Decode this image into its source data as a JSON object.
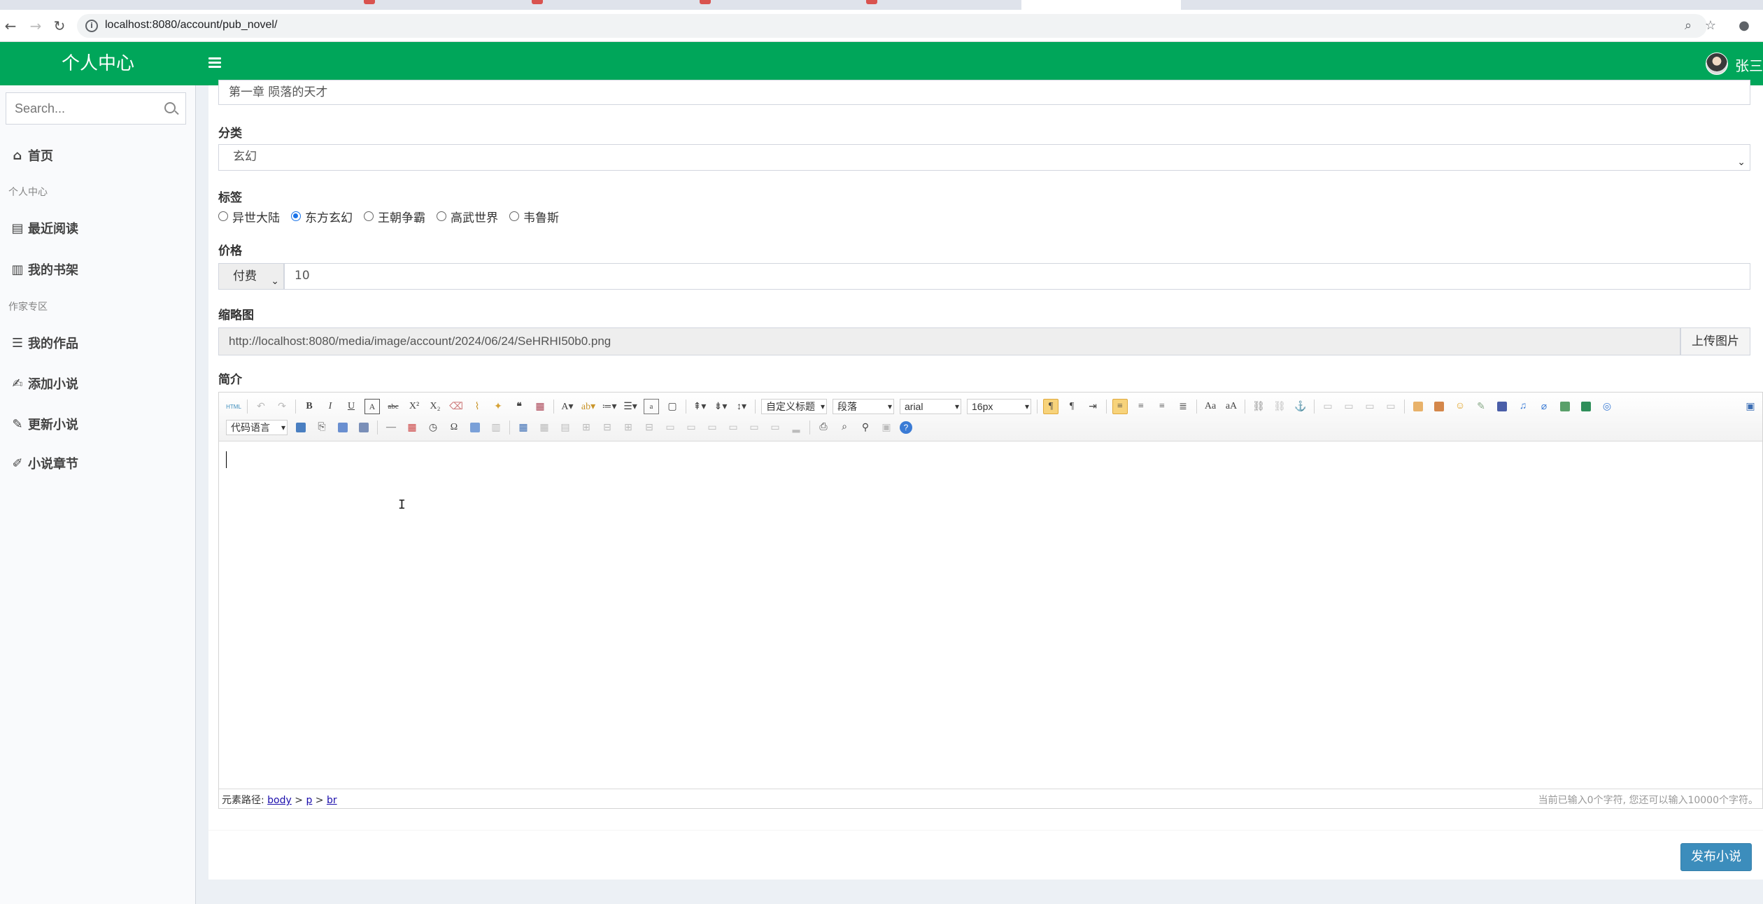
{
  "browser": {
    "url": "localhost:8080/account/pub_novel/"
  },
  "header": {
    "logo": "个人中心",
    "username": "张三"
  },
  "sidebar": {
    "search_placeholder": "Search...",
    "items": [
      {
        "label": "首页",
        "icon": "home-icon"
      },
      {
        "header": "个人中心"
      },
      {
        "label": "最近阅读",
        "icon": "book-open-icon"
      },
      {
        "label": "我的书架",
        "icon": "bookshelf-icon"
      },
      {
        "header": "作家专区"
      },
      {
        "label": "我的作品",
        "icon": "list-icon"
      },
      {
        "label": "添加小说",
        "icon": "pen-hand-icon"
      },
      {
        "label": "更新小说",
        "icon": "pencil-icon"
      },
      {
        "label": "小说章节",
        "icon": "edit-icon"
      }
    ]
  },
  "form": {
    "title_value": "第一章 陨落的天才",
    "category_label": "分类",
    "category_value": "玄幻",
    "tags_label": "标签",
    "tags": [
      "异世大陆",
      "东方玄幻",
      "王朝争霸",
      "高武世界",
      "韦鲁斯"
    ],
    "selected_tag": "东方玄幻",
    "price_label": "价格",
    "price_type": "付费",
    "price_value": "10",
    "thumb_label": "缩略图",
    "thumb_url": "http://localhost:8080/media/image/account/2024/06/24/SeHRHI50b0.png",
    "upload_button": "上传图片",
    "intro_label": "简介"
  },
  "editor": {
    "toolbar": {
      "html_btn": "HTML",
      "custom_title": "自定义标题",
      "paragraph": "段落",
      "font_family": "arial",
      "font_size": "16px",
      "code_lang": "代码语言"
    },
    "path_label": "元素路径:",
    "path": [
      "body",
      "p",
      "br"
    ],
    "word_count": "当前已输入0个字符, 您还可以输入10000个字符。"
  },
  "footer": {
    "publish_button": "发布小说"
  },
  "colors": {
    "header_green": "#00a65a",
    "primary_blue": "#3c8dbc"
  }
}
